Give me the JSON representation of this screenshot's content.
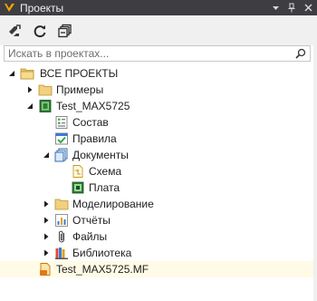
{
  "window": {
    "title": "Проекты",
    "buttons": [
      "dropdown-icon",
      "pin-icon",
      "close-icon"
    ]
  },
  "toolbar": {
    "items": [
      "sync-tree-icon",
      "refresh-icon",
      "collapse-all-icon"
    ]
  },
  "search": {
    "placeholder": "Искать в проектах...",
    "value": ""
  },
  "tree": {
    "root": {
      "label": "ВСЕ ПРОЕКТЫ",
      "expanded": true,
      "icon": "folder-open-icon"
    },
    "items": [
      {
        "label": "Примеры",
        "level": 1,
        "expanded": false,
        "icon": "folder-icon"
      },
      {
        "label": "Test_MAX5725",
        "level": 1,
        "expanded": true,
        "icon": "project-icon"
      },
      {
        "label": "Состав",
        "level": 2,
        "icon": "composition-icon"
      },
      {
        "label": "Правила",
        "level": 2,
        "icon": "rules-icon"
      },
      {
        "label": "Документы",
        "level": 2,
        "expanded": true,
        "icon": "documents-icon"
      },
      {
        "label": "Схема",
        "level": 3,
        "icon": "schematic-icon"
      },
      {
        "label": "Плата",
        "level": 3,
        "icon": "pcb-icon"
      },
      {
        "label": "Моделирование",
        "level": 2,
        "expanded": false,
        "icon": "folder-icon"
      },
      {
        "label": "Отчёты",
        "level": 2,
        "expanded": false,
        "icon": "reports-icon"
      },
      {
        "label": "Файлы",
        "level": 2,
        "expanded": false,
        "icon": "files-icon"
      },
      {
        "label": "Библиотека",
        "level": 2,
        "expanded": false,
        "icon": "library-icon"
      },
      {
        "label": "Test_MAX5725.MF",
        "level": 1,
        "icon": "mf-file-icon",
        "selected": true
      }
    ]
  },
  "colors": {
    "titlebar": "#3e3e42",
    "toolbar": "#f0f0f0",
    "selection": "#fffbe6",
    "accent": "#007acc"
  }
}
